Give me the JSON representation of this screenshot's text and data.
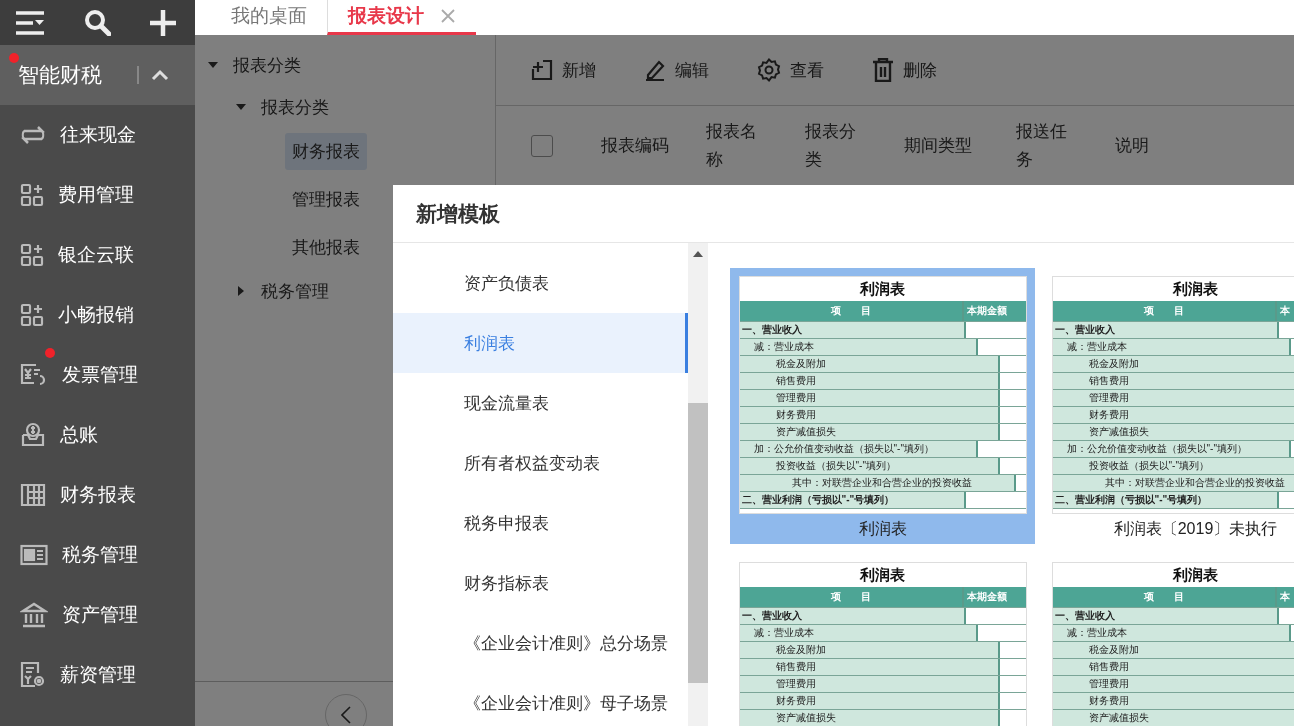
{
  "sidebar": {
    "group": {
      "label": "智能财税",
      "badge": true,
      "expanded": true
    },
    "items": [
      {
        "label": "往来现金",
        "badge": false
      },
      {
        "label": "费用管理",
        "badge": false
      },
      {
        "label": "银企云联",
        "badge": false
      },
      {
        "label": "小畅报销",
        "badge": false
      },
      {
        "label": "发票管理",
        "badge": true
      },
      {
        "label": "总账",
        "badge": false
      },
      {
        "label": "财务报表",
        "badge": false
      },
      {
        "label": "税务管理",
        "badge": false
      },
      {
        "label": "资产管理",
        "badge": false
      },
      {
        "label": "薪资管理",
        "badge": false
      }
    ]
  },
  "tabs": [
    {
      "label": "我的桌面",
      "selected": false
    },
    {
      "label": "报表设计",
      "selected": true
    }
  ],
  "tree": [
    {
      "label": "报表分类",
      "expanded": true,
      "children": [
        {
          "label": "报表分类",
          "expanded": true,
          "children": [
            {
              "label": "财务报表",
              "selected": true
            },
            {
              "label": "管理报表",
              "selected": false
            },
            {
              "label": "其他报表",
              "selected": false
            }
          ]
        },
        {
          "label": "税务管理",
          "expanded": false
        }
      ]
    }
  ],
  "toolbar": [
    {
      "label": "新增"
    },
    {
      "label": "编辑"
    },
    {
      "label": "查看"
    },
    {
      "label": "删除"
    }
  ],
  "table": {
    "select_all": {
      "checked": false
    },
    "columns": [
      "报表编码",
      "报表名称",
      "报表分类",
      "期间类型",
      "报送任务",
      "说明"
    ]
  },
  "dialog": {
    "title": "新增模板",
    "categories": [
      {
        "label": "资产负债表",
        "selected": false
      },
      {
        "label": "利润表",
        "selected": true
      },
      {
        "label": "现金流量表",
        "selected": false
      },
      {
        "label": "所有者权益变动表",
        "selected": false
      },
      {
        "label": "税务申报表",
        "selected": false
      },
      {
        "label": "财务指标表",
        "selected": false
      },
      {
        "label": "《企业会计准则》总分场景",
        "selected": false
      },
      {
        "label": "《企业会计准则》母子场景",
        "selected": false
      }
    ],
    "templates": [
      {
        "caption": "利润表",
        "selected": true,
        "thumbnail": {
          "title": "利润表",
          "columns": [
            "项　　目",
            "本期金额"
          ],
          "rows": [
            {
              "kind": "heading",
              "text": "一、营业收入"
            },
            {
              "kind": "group",
              "text": "减：营业成本"
            },
            {
              "kind": "item",
              "text": "税金及附加"
            },
            {
              "kind": "item",
              "text": "销售费用"
            },
            {
              "kind": "item",
              "text": "管理费用"
            },
            {
              "kind": "item",
              "text": "财务费用"
            },
            {
              "kind": "item",
              "text": "资产减值损失"
            },
            {
              "kind": "group",
              "text": "加：公允价值变动收益（损失以\"-\"填列）"
            },
            {
              "kind": "item",
              "text": "投资收益（损失以\"-\"填列）"
            },
            {
              "kind": "detail",
              "text": "其中：对联营企业和合营企业的投资收益"
            },
            {
              "kind": "heading",
              "text": "二、营业利润（亏损以\"-\"号填列）"
            }
          ]
        }
      },
      {
        "caption": "利润表〔2019〕未执行",
        "selected": false,
        "thumbnail": {
          "title": "利润表",
          "columns": [
            "项　　目",
            "本"
          ],
          "rows": [
            {
              "kind": "heading",
              "text": "一、营业收入"
            },
            {
              "kind": "group",
              "text": "减：营业成本"
            },
            {
              "kind": "item",
              "text": "税金及附加"
            },
            {
              "kind": "item",
              "text": "销售费用"
            },
            {
              "kind": "item",
              "text": "管理费用"
            },
            {
              "kind": "item",
              "text": "财务费用"
            },
            {
              "kind": "item",
              "text": "资产减值损失"
            },
            {
              "kind": "group",
              "text": "加：公允价值变动收益（损失以\"-\"填列）"
            },
            {
              "kind": "item",
              "text": "投资收益（损失以\"-\"填列）"
            },
            {
              "kind": "detail",
              "text": "其中：对联营企业和合营企业的投资收益"
            },
            {
              "kind": "heading",
              "text": "二、营业利润（亏损以\"-\"号填列）"
            }
          ]
        }
      },
      {
        "selected": false,
        "thumbnail": {
          "title": "利润表",
          "columns": [
            "项　　目",
            "本期金额"
          ],
          "rows": [
            {
              "kind": "heading",
              "text": "一、营业收入"
            },
            {
              "kind": "group",
              "text": "减：营业成本"
            },
            {
              "kind": "item",
              "text": "税金及附加"
            },
            {
              "kind": "item",
              "text": "销售费用"
            },
            {
              "kind": "item",
              "text": "管理费用"
            },
            {
              "kind": "item",
              "text": "财务费用"
            },
            {
              "kind": "item",
              "text": "资产减值损失"
            }
          ]
        }
      },
      {
        "selected": false,
        "thumbnail": {
          "title": "利润表",
          "columns": [
            "项　　目",
            "本"
          ],
          "rows": [
            {
              "kind": "heading",
              "text": "一、营业收入"
            },
            {
              "kind": "group",
              "text": "减：营业成本"
            },
            {
              "kind": "item",
              "text": "税金及附加"
            },
            {
              "kind": "item",
              "text": "销售费用"
            },
            {
              "kind": "item",
              "text": "管理费用"
            },
            {
              "kind": "item",
              "text": "财务费用"
            },
            {
              "kind": "item",
              "text": "资产减值损失"
            }
          ]
        }
      }
    ]
  }
}
